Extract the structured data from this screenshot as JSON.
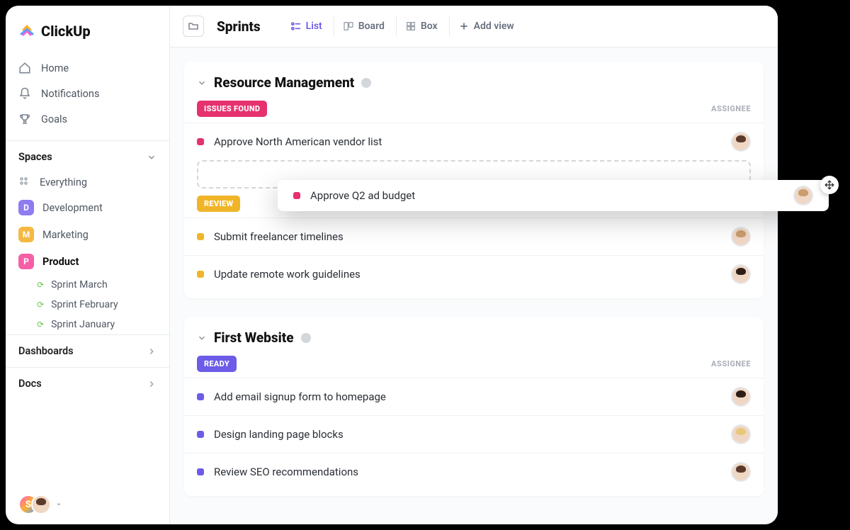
{
  "brand": "ClickUp",
  "nav": {
    "home": "Home",
    "notifications": "Notifications",
    "goals": "Goals"
  },
  "spaces": {
    "header": "Spaces",
    "everything": "Everything",
    "items": [
      {
        "letter": "D",
        "label": "Development",
        "color": "#8e7cf0"
      },
      {
        "letter": "M",
        "label": "Marketing",
        "color": "#f5b942"
      },
      {
        "letter": "P",
        "label": "Product",
        "color": "#f55fa6"
      }
    ],
    "sprints": [
      "Sprint  March",
      "Sprint  February",
      "Sprint January"
    ]
  },
  "sections": {
    "dashboards": "Dashboards",
    "docs": "Docs"
  },
  "header": {
    "title": "Sprints",
    "views": {
      "list": "List",
      "board": "Board",
      "box": "Box",
      "add": "Add view"
    }
  },
  "columns": {
    "assignee": "ASSIGNEE"
  },
  "lists": [
    {
      "title": "Resource Management",
      "groups": [
        {
          "status_label": "ISSUES FOUND",
          "status_color": "#e6316f",
          "tasks": [
            {
              "title": "Approve North American vendor list",
              "dot": "#e6316f"
            }
          ],
          "has_dropzone": true
        },
        {
          "status_label": "REVIEW",
          "status_color": "#f0b429",
          "tasks": [
            {
              "title": "Submit freelancer timelines",
              "dot": "#f0b429"
            },
            {
              "title": "Update remote work guidelines",
              "dot": "#f0b429"
            }
          ]
        }
      ]
    },
    {
      "title": "First Website",
      "groups": [
        {
          "status_label": "READY",
          "status_color": "#6c5ce7",
          "tasks": [
            {
              "title": "Add email signup form to homepage",
              "dot": "#6c5ce7"
            },
            {
              "title": "Design landing page blocks",
              "dot": "#6c5ce7"
            },
            {
              "title": "Review SEO recommendations",
              "dot": "#6c5ce7"
            }
          ]
        }
      ]
    }
  ],
  "dragging": {
    "title": "Approve Q2 ad budget",
    "dot": "#e6316f"
  },
  "footer_avatar_letter": "S"
}
